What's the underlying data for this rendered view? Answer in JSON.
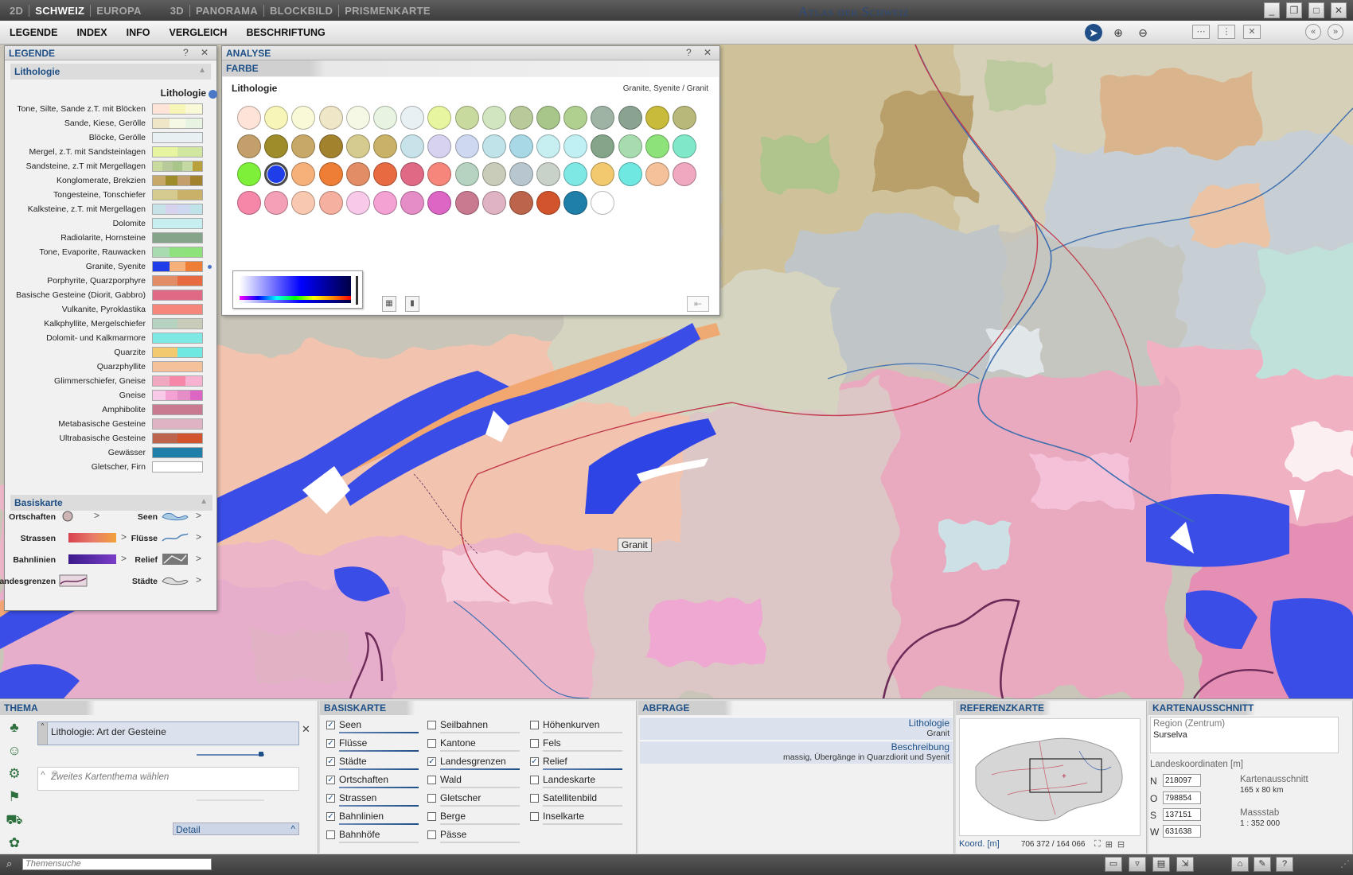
{
  "topbar": {
    "modes": [
      "2D",
      "SCHWEIZ",
      "EUROPA",
      "3D",
      "PANORAMA",
      "BLOCKBILD",
      "PRISMENKARTE"
    ],
    "app_title": "Atlas der Schweiz"
  },
  "menu": [
    "LEGENDE",
    "INDEX",
    "INFO",
    "VERGLEICH",
    "BESCHRIFTUNG"
  ],
  "legend": {
    "title": "LEGENDE",
    "controls": "? ✕",
    "section_lithologie": "Lithologie",
    "lithologie_title": "Lithologie",
    "items": [
      {
        "label": "Tone, Silte, Sande z.T. mit Blöcken",
        "colors": [
          "#fde3d8",
          "#f7f5b8",
          "#f9f9d8"
        ]
      },
      {
        "label": "Sande, Kiese, Gerölle",
        "colors": [
          "#efe5c7",
          "#f6f8e6",
          "#e7f4e2"
        ]
      },
      {
        "label": "Blöcke, Gerölle",
        "colors": [
          "#e8f0f3"
        ]
      },
      {
        "label": "Mergel, z.T. mit Sandsteinlagen",
        "colors": [
          "#e8f5a0",
          "#d1e6a1"
        ]
      },
      {
        "label": "Sandsteine, z.T mit Mergellagen",
        "colors": [
          "#c9da9e",
          "#b8c99a",
          "#a8c68a",
          "#c4d8a4",
          "#b8a03a"
        ]
      },
      {
        "label": "Konglomerate, Brekzien",
        "colors": [
          "#c8a868",
          "#9e8b2a",
          "#c3a06b",
          "#a3822e"
        ]
      },
      {
        "label": "Tongesteine, Tonschiefer",
        "colors": [
          "#d6cb8e",
          "#c9b268"
        ]
      },
      {
        "label": "Kalksteine, z.T. mit Mergellagen",
        "colors": [
          "#c7e2e8",
          "#d7d2ee",
          "#ced8f0",
          "#bfe3e9"
        ]
      },
      {
        "label": "Dolomite",
        "colors": [
          "#c7eef0"
        ]
      },
      {
        "label": "Radiolarite, Hornsteine",
        "colors": [
          "#85a58b"
        ]
      },
      {
        "label": "Tone, Evaporite, Rauwacken",
        "colors": [
          "#a8dcb0",
          "#8fe07f",
          "#8de37a"
        ]
      },
      {
        "label": "Granite, Syenite",
        "colors": [
          "#1f3de8",
          "#f6b17a",
          "#ee7e35"
        ],
        "selected": true
      },
      {
        "label": "Porphyrite, Quarzporphyre",
        "colors": [
          "#e28d66",
          "#e86a40"
        ]
      },
      {
        "label": "Basische Gesteine (Diorit, Gabbro)",
        "colors": [
          "#e06a86"
        ]
      },
      {
        "label": "Vulkanite, Pyroklastika",
        "colors": [
          "#f6867b"
        ]
      },
      {
        "label": "Kalkphyllite, Mergelschiefer",
        "colors": [
          "#b5d3c0",
          "#c9ccb8"
        ]
      },
      {
        "label": "Dolomit- und Kalkmarmore",
        "colors": [
          "#7ee8e4"
        ]
      },
      {
        "label": "Quarzite",
        "colors": [
          "#f2c96e",
          "#6fe8e2"
        ]
      },
      {
        "label": "Quarzphyllite",
        "colors": [
          "#f4c19a"
        ]
      },
      {
        "label": "Glimmerschiefer, Gneise",
        "colors": [
          "#f0a8c0",
          "#f687a8",
          "#f7b2d2"
        ]
      },
      {
        "label": "Gneise",
        "colors": [
          "#f8c9e8",
          "#f4a1d4",
          "#e58dc7",
          "#dd66c4"
        ]
      },
      {
        "label": "Amphibolite",
        "colors": [
          "#c97a90"
        ]
      },
      {
        "label": "Metabasische Gesteine",
        "colors": [
          "#dfb3c3"
        ]
      },
      {
        "label": "Ultrabasische Gesteine",
        "colors": [
          "#bd654c",
          "#d2542c"
        ]
      },
      {
        "label": "Gewässer",
        "colors": [
          "#1f7fa8"
        ]
      },
      {
        "label": "Gletscher, Firn",
        "colors": [
          "#ffffff"
        ]
      }
    ],
    "section_basiskarte": "Basiskarte",
    "basis": [
      [
        "Ortschaften",
        "Seen"
      ],
      [
        "Strassen",
        "Flüsse"
      ],
      [
        "Bahnlinien",
        "Relief"
      ],
      [
        "Landesgrenzen",
        "Städte"
      ]
    ]
  },
  "analyse": {
    "title": "ANALYSE",
    "tab": "FARBE",
    "heading": "Lithologie",
    "selection": "Granite, Syenite / Granit",
    "palette": [
      "#fde3d8",
      "#f7f5b8",
      "#f9f9d8",
      "#efe5c7",
      "#f6f8e6",
      "#e7f4e2",
      "#e8f0f3",
      "#e8f5a0",
      "#c9da9e",
      "#d1e6c0",
      "#b8c99a",
      "#a8c68a",
      "#b0d090",
      "#9fb3a4",
      "#8aa290",
      "#c8ba3a",
      "#b8b87a",
      "#c3a06b",
      "#9e8b2a",
      "#c8a868",
      "#a3822e",
      "#d6cb8e",
      "#c9b268",
      "#c7e2e8",
      "#d7d2ee",
      "#ced8f0",
      "#bfe3e9",
      "#a8d8e6",
      "#c7eef0",
      "#c0f0f4",
      "#85a58b",
      "#a8dcb0",
      "#8de37a",
      "#7fe8c8",
      "#7ef03a",
      "#1f3de8",
      "#f6b17a",
      "#ee7e35",
      "#e28d66",
      "#e86a40",
      "#e06a86",
      "#f6867b",
      "#b5d3c0",
      "#c9ccb8",
      "#b8c7cf",
      "#c8d2c8",
      "#7ee8e4",
      "#f2c96e",
      "#6fe8e2",
      "#f4c19a",
      "#f0a8c0",
      "#f687a8",
      "#f4a1b8",
      "#f8c9b0",
      "#f6b0a0",
      "#f8c9e8",
      "#f4a1d4",
      "#e58dc7",
      "#dd66c4",
      "#c97a90",
      "#dfb3c3",
      "#bd654c",
      "#d2542c",
      "#1f7fa8",
      "#ffffff"
    ],
    "selected_index": 35
  },
  "map": {
    "callout": "Granit"
  },
  "thema": {
    "title": "THEMA",
    "selected": "Lithologie: Art der Gesteine",
    "second_placeholder": "Zweites Kartenthema wählen",
    "detail": "Detail"
  },
  "basiskarte": {
    "title": "BASISKARTE",
    "col1": [
      {
        "label": "Seen",
        "checked": true
      },
      {
        "label": "Flüsse",
        "checked": true
      },
      {
        "label": "Städte",
        "checked": true
      },
      {
        "label": "Ortschaften",
        "checked": true
      },
      {
        "label": "Strassen",
        "checked": true
      },
      {
        "label": "Bahnlinien",
        "checked": true
      },
      {
        "label": "Bahnhöfe",
        "checked": false
      }
    ],
    "col2": [
      {
        "label": "Seilbahnen",
        "checked": false
      },
      {
        "label": "Kantone",
        "checked": false
      },
      {
        "label": "Landesgrenzen",
        "checked": true
      },
      {
        "label": "Wald",
        "checked": false
      },
      {
        "label": "Gletscher",
        "checked": false
      },
      {
        "label": "Berge",
        "checked": false
      },
      {
        "label": "Pässe",
        "checked": false
      }
    ],
    "col3": [
      {
        "label": "Höhenkurven",
        "checked": false
      },
      {
        "label": "Fels",
        "checked": false
      },
      {
        "label": "Relief",
        "checked": true
      },
      {
        "label": "Landeskarte",
        "checked": false
      },
      {
        "label": "Satellitenbild",
        "checked": false
      },
      {
        "label": "Inselkarte",
        "checked": false
      }
    ]
  },
  "abfrage": {
    "title": "ABFRAGE",
    "row1_title": "Lithologie",
    "row1_value": "Granit",
    "row2_title": "Beschreibung",
    "row2_value": "massig, Übergänge in Quarzdiorit und Syenit"
  },
  "referenz": {
    "title": "REFERENZKARTE",
    "koord_label": "Koord. [m]",
    "koord_value": "706 372 / 164 066"
  },
  "kartenausschnitt": {
    "title": "KARTENAUSSCHNITT",
    "region_label": "Region (Zentrum)",
    "region_value": "Surselva",
    "lk_title": "Landeskoordinaten [m]",
    "coords": [
      {
        "k": "N",
        "v": "218097"
      },
      {
        "k": "O",
        "v": "798854"
      },
      {
        "k": "S",
        "v": "137151"
      },
      {
        "k": "W",
        "v": "631638"
      }
    ],
    "ausschnitt_label": "Kartenausschnitt",
    "ausschnitt_value": "165 x 80 km",
    "massstab_label": "Massstab",
    "massstab_value": "1 : 352 000"
  },
  "statusbar": {
    "search_placeholder": "Themensuche"
  },
  "icons": {
    "pointer": "cursor-icon",
    "zoom_in": "zoom-in-icon",
    "zoom_out": "zoom-out-icon"
  }
}
